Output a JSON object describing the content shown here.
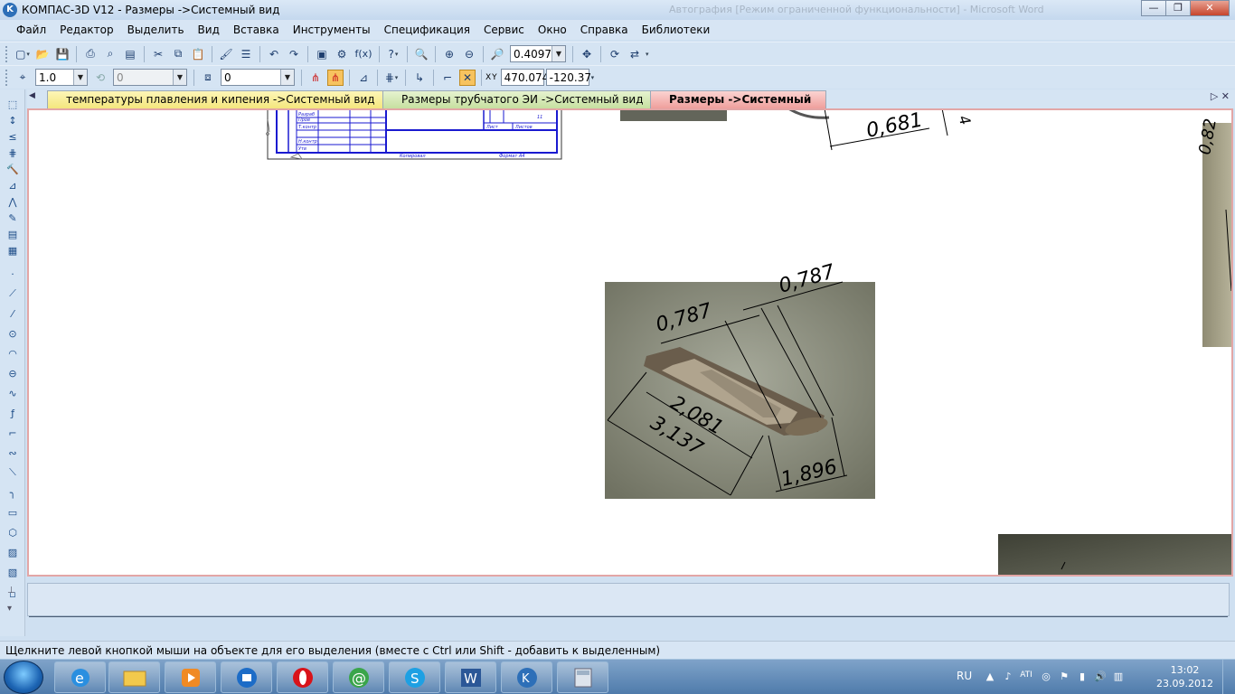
{
  "window": {
    "title": "КОМПАС-3D V12 - Размеры ->Системный вид",
    "ghost_title": "Автография [Режим ограниченной функциональности] - Microsoft Word",
    "minimize": "—",
    "maximize": "❐",
    "close": "✕"
  },
  "menu": [
    "Файл",
    "Редактор",
    "Выделить",
    "Вид",
    "Вставка",
    "Инструменты",
    "Спецификация",
    "Сервис",
    "Окно",
    "Справка",
    "Библиотеки"
  ],
  "toolbar1": {
    "zoom_value": "0.4097",
    "func_label": "f(x)"
  },
  "toolbar2": {
    "step_value": "1.0",
    "angle_value": "0",
    "layer_value": "0",
    "x_label": "X",
    "y_label": "Y",
    "x_value": "470.074",
    "y_value": "-120.37"
  },
  "tabs": [
    {
      "label": "температуры плавления и кипения ->Системный вид"
    },
    {
      "label": "Размеры трубчатого ЭИ ->Системный вид"
    },
    {
      "label": "Размеры ->Системный вид"
    }
  ],
  "tabs_nav": {
    "left": "◀",
    "right": "▷ ✕"
  },
  "canvas": {
    "main_photo_dims": [
      "0,787",
      "0,787",
      "2,081",
      "3,137",
      "1,896"
    ],
    "top_photo_dim": "0,681",
    "top_photo_dim2": "4",
    "right_photo_dim": "0,82",
    "title_block": {
      "list_label": "Лист",
      "lists_label": "Листов",
      "lists_value": "11",
      "copied": "Копировал",
      "format": "Формат   А4",
      "rows": [
        "Разраб",
        "Пров",
        "Т.контр",
        "Н.контр",
        "Утв"
      ]
    }
  },
  "status": {
    "hint": "Щелкните левой кнопкой мыши на объекте для его выделения (вместе с Ctrl или Shift - добавить к выделенным)"
  },
  "taskbar": {
    "lang": "RU",
    "time": "13:02",
    "date": "23.09.2012"
  }
}
